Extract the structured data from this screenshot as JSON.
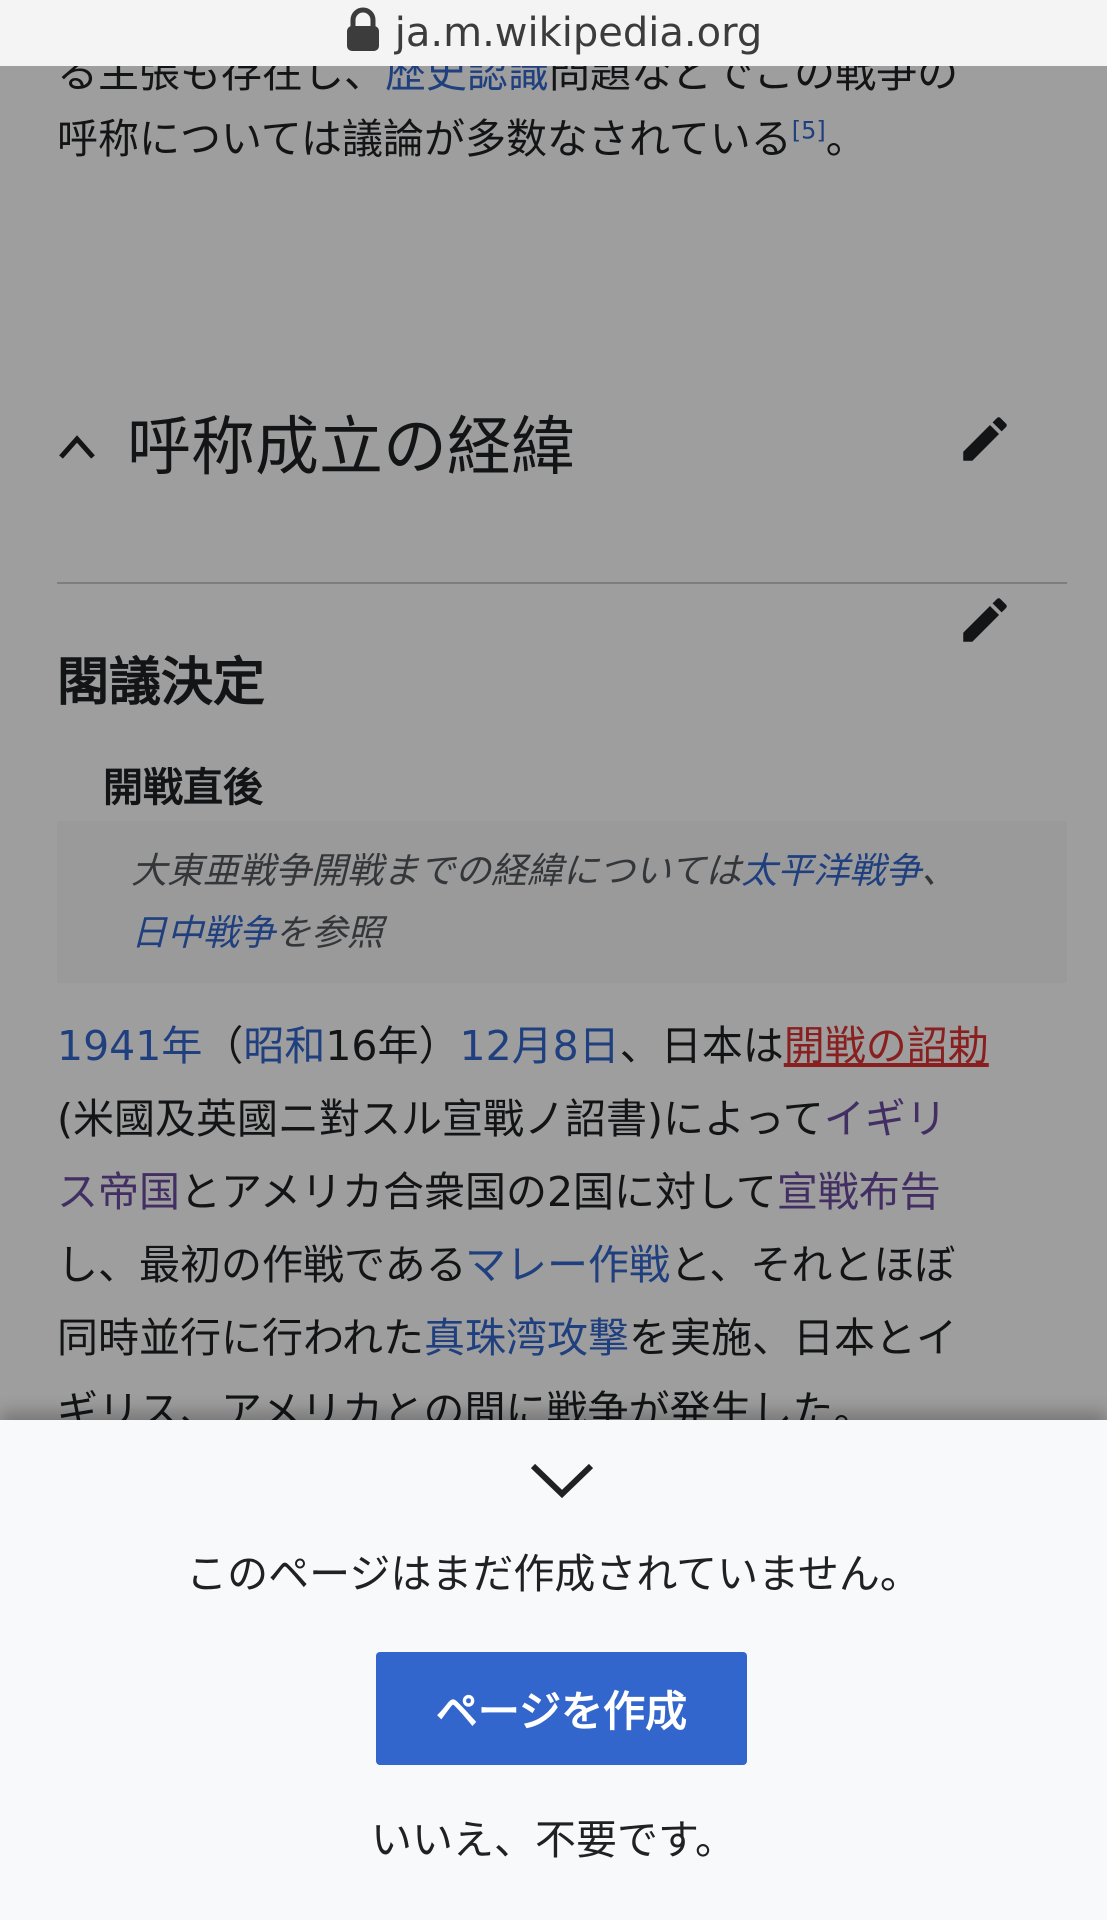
{
  "browser": {
    "url": "ja.m.wikipedia.org"
  },
  "intro": {
    "line1_a": "る主張も存在し、",
    "line1_link": "歴史認識",
    "line1_b": "問題などでこの戦争の",
    "line2_a": "呼称については議論が多数なされている",
    "line2_ref": "[5]",
    "line2_b": "。"
  },
  "section": {
    "title": "呼称成立の経緯"
  },
  "subsection": {
    "title": "閣議決定"
  },
  "subsubsection": {
    "title": "開戦直後"
  },
  "hatnote": {
    "a": "大東亜戦争開戦までの経緯については",
    "link1": "太平洋戦争",
    "sep": "、",
    "link2": "日中戦争",
    "b": "を参照"
  },
  "body": {
    "l1_link1": "1941年",
    "l1_t1": "（",
    "l1_link2": "昭和",
    "l1_t2": "16年）",
    "l1_link3": "12月8日",
    "l1_t3": "、日本は",
    "l1_red": "開戦の詔勅",
    "l2_t1": "(米國及英國ニ對スル宣戰ノ詔書)によって",
    "l2_link": "イギリ",
    "l3_link": "ス帝国",
    "l3_t1": "とアメリカ合衆国の2国に対して",
    "l3_link2": "宣戦布告",
    "l4_t1": "し、最初の作戦である",
    "l4_link": "マレー作戦",
    "l4_t2": "と、それとほぼ",
    "l5_t1": "同時並行に行われた",
    "l5_link": "真珠湾攻撃",
    "l5_t2": "を実施、日本とイ",
    "l6_t1": "ギリス、アメリカとの間に戦争が発生した。"
  },
  "drawer": {
    "message": "このページはまだ作成されていません。",
    "create_label": "ページを作成",
    "dismiss_label": "いいえ、不要です。"
  },
  "colors": {
    "link": "#3366cc",
    "visited": "#6b4ba1",
    "redlink": "#dd3333",
    "button": "#3366cc"
  }
}
